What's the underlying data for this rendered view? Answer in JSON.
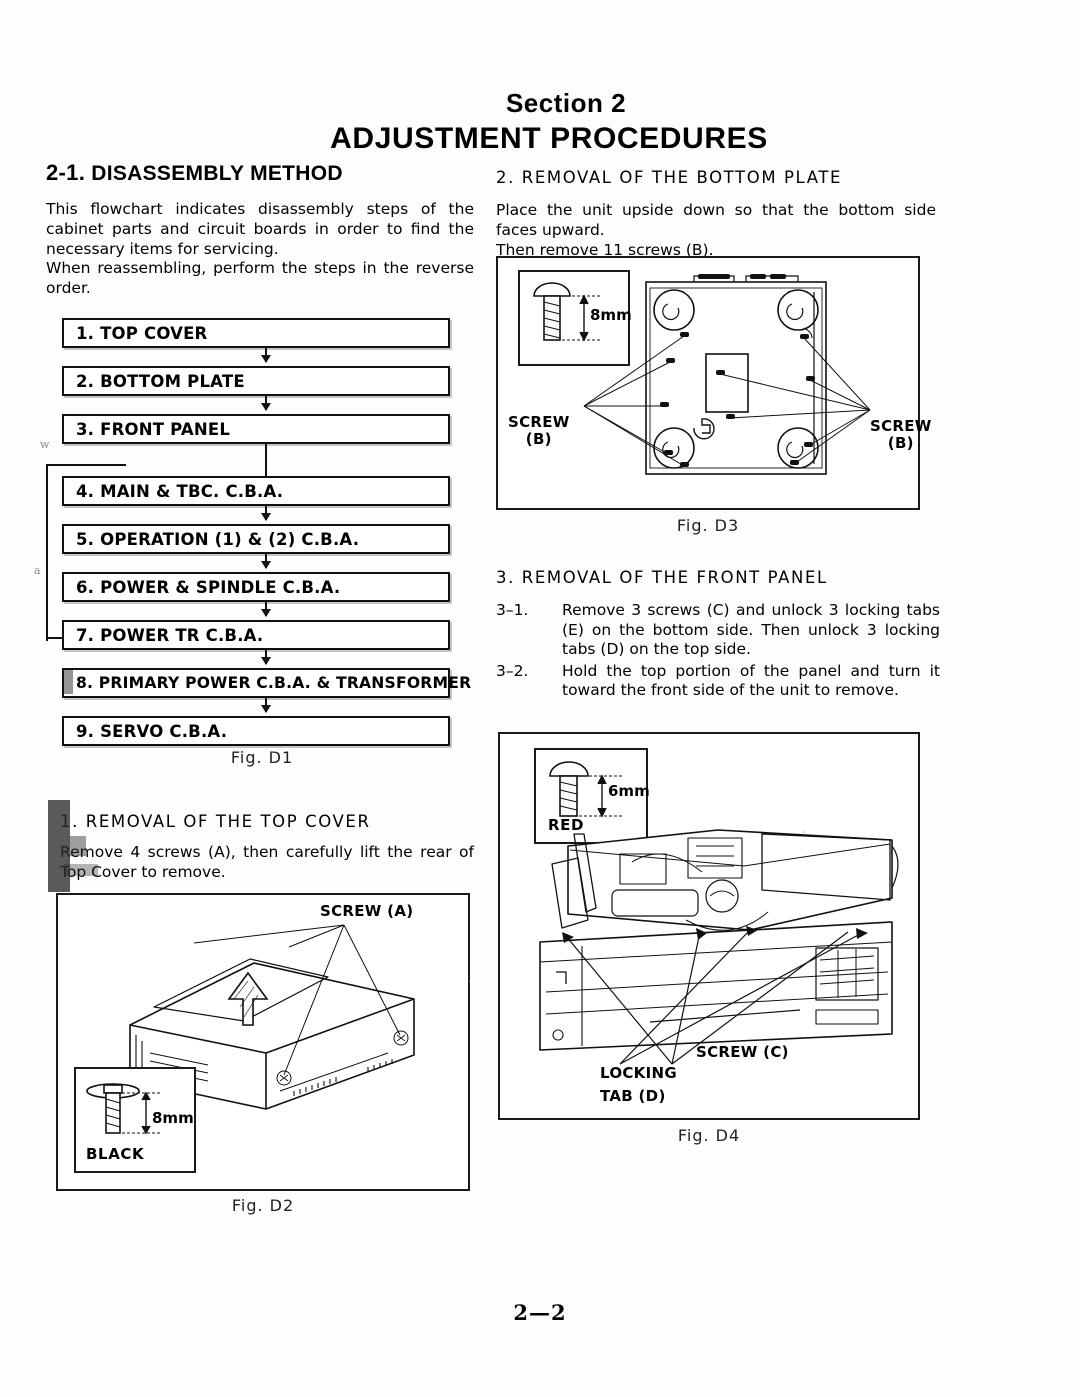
{
  "header": {
    "section_label": "Section  2",
    "title": "ADJUSTMENT PROCEDURES"
  },
  "left_column": {
    "section_number": "2-1.",
    "section_title": "DISASSEMBLY METHOD",
    "intro_paragraph": "This flowchart indicates disassembly steps of the cabinet parts and circuit boards in order to find the necessary items for servicing.",
    "intro_paragraph_2": "When reassembling, perform the steps in the reverse order.",
    "flowchart": {
      "caption": "Fig.  D1",
      "steps": [
        {
          "label": "1.  TOP COVER"
        },
        {
          "label": "2. BOTTOM PLATE"
        },
        {
          "label": "3.  FRONT PANEL"
        },
        {
          "label": "4.  MAIN & TBC. C.B.A."
        },
        {
          "label": "5.  OPERATION (1) & (2) C.B.A."
        },
        {
          "label": "6.  POWER & SPINDLE C.B.A."
        },
        {
          "label": "7.  POWER TR C.B.A."
        },
        {
          "label": "8.  PRIMARY POWER C.B.A. & TRANSFORMER"
        },
        {
          "label": "9.  SERVO C.B.A."
        }
      ]
    },
    "topcover": {
      "heading": "1.  REMOVAL OF THE TOP COVER",
      "text": "Remove 4 screws (A), then carefully lift the rear of Top Cover to remove.",
      "figure": {
        "caption": "Fig.  D2",
        "screw_callout": "SCREW (A)",
        "inset_dimension": "8mm",
        "inset_color": "BLACK"
      }
    }
  },
  "right_column": {
    "bottom_plate": {
      "heading": "2.  REMOVAL OF THE BOTTOM PLATE",
      "text_line_1": "Place the unit upside down so that the bottom side faces upward.",
      "text_line_2": "Then remove 11 screws (B).",
      "figure": {
        "caption": "Fig.  D3",
        "inset_dimension": "8mm",
        "screw_left_line1": "SCREW",
        "screw_left_line2": "(B)",
        "screw_right_line1": "SCREW",
        "screw_right_line2": "(B)"
      }
    },
    "front_panel": {
      "heading": "3.  REMOVAL OF THE FRONT PANEL",
      "steps": [
        {
          "key": "3–1.",
          "text": "Remove 3 screws (C) and unlock 3 locking tabs (E) on the bottom side. Then unlock 3 locking tabs (D) on the top side."
        },
        {
          "key": "3–2.",
          "text": "Hold the top portion of the panel and turn it toward the front side of the unit to remove."
        }
      ],
      "figure": {
        "caption": "Fig.  D4",
        "inset_dimension": "6mm",
        "inset_color": "RED",
        "callout_screw": "SCREW (C)",
        "callout_tab_line1": "LOCKING",
        "callout_tab_line2": "TAB (D)"
      }
    }
  },
  "footer": {
    "page_number": "2—2"
  },
  "colors": {
    "ink": "#111111",
    "paper": "#fdfdfb"
  }
}
